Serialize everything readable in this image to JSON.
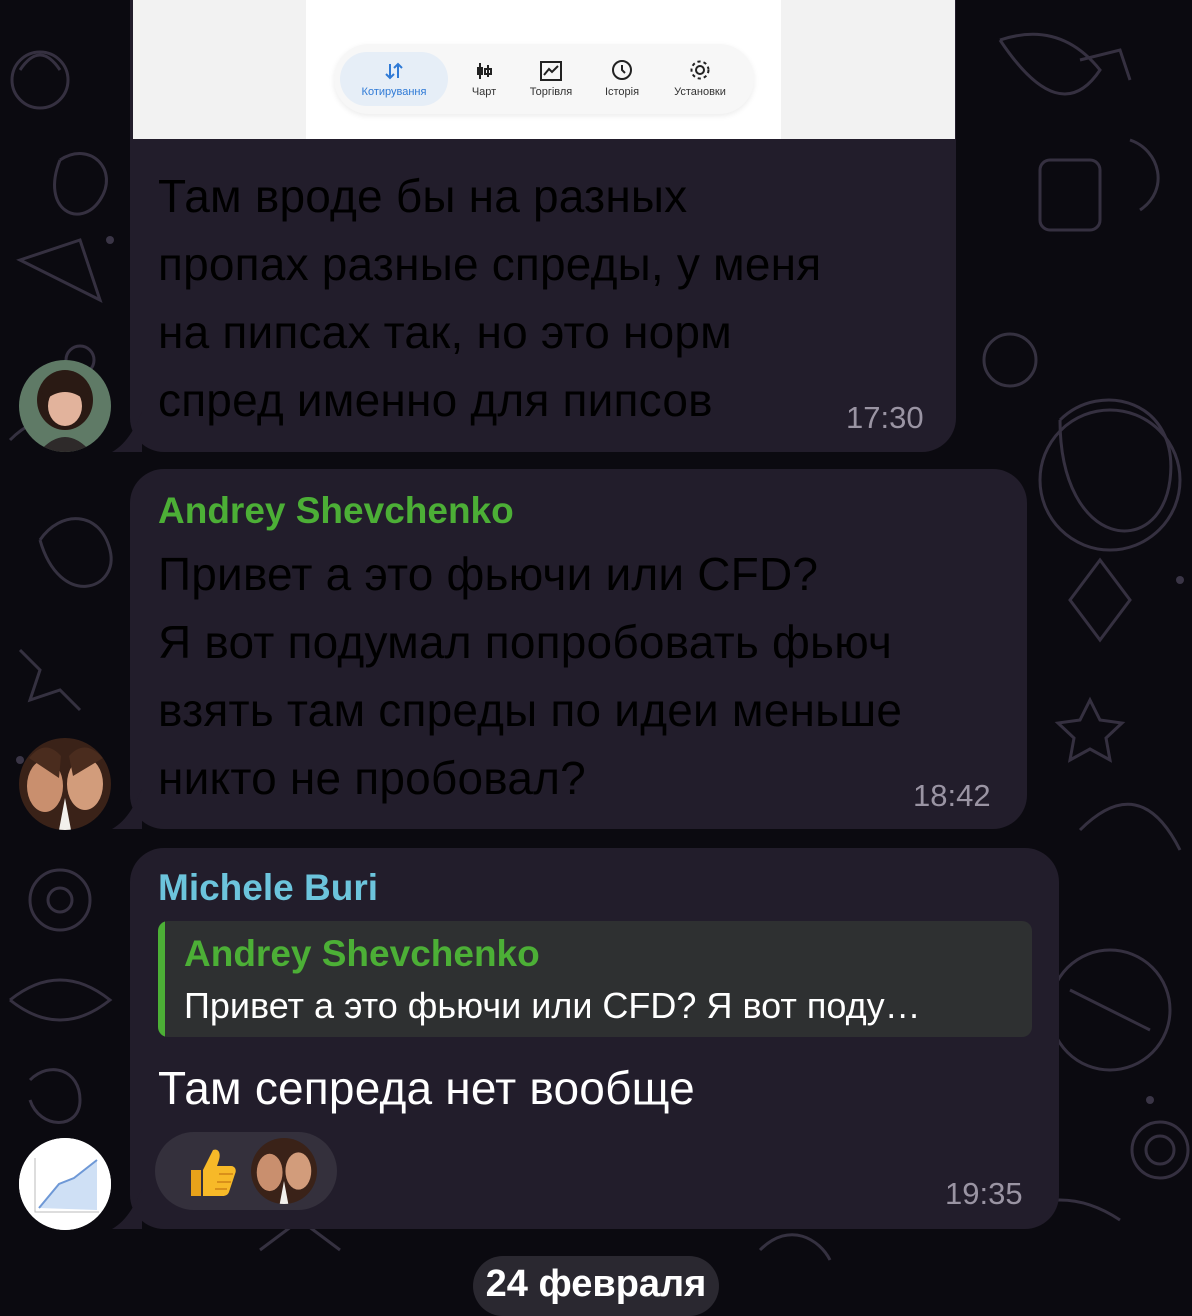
{
  "colors": {
    "background": "#0b0a10",
    "bubble": "#221d2b",
    "sender_green": "#4caf36",
    "sender_cyan": "#6cc4dc",
    "timestamp": "#9a94a3",
    "tab_active": "#2f7ad6"
  },
  "screenshot_tabs": [
    {
      "label": "Котирування",
      "icon": "swap-arrows-icon",
      "active": true
    },
    {
      "label": "Чарт",
      "icon": "candlestick-icon",
      "active": false
    },
    {
      "label": "Торгівля",
      "icon": "trade-chart-icon",
      "active": false
    },
    {
      "label": "Історія",
      "icon": "history-icon",
      "active": false
    },
    {
      "label": "Установки",
      "icon": "gear-icon",
      "active": false
    }
  ],
  "messages": [
    {
      "lines": [
        "Там вроде бы на разных",
        "пропах разные спреды, у меня",
        "на пипсах так, но это норм",
        "спред именно для пипсов"
      ],
      "time": "17:30"
    },
    {
      "sender": "Andrey Shevchenko",
      "lines": [
        "Привет а это фьючи или CFD?",
        "Я вот подумал попробовать фьюч",
        "взять там спреды по идеи меньше",
        "никто не пробовал?"
      ],
      "time": "18:42"
    },
    {
      "sender": "Michele Buri",
      "reply": {
        "sender": "Andrey Shevchenko",
        "text": "Привет а это фьючи или CFD? Я вот поду…"
      },
      "lines": [
        "Там сепреда нет вообще"
      ],
      "reaction": {
        "emoji": "👍",
        "icon": "thumbs-up-icon"
      },
      "time": "19:35"
    }
  ],
  "date_separator": "24 февраля"
}
